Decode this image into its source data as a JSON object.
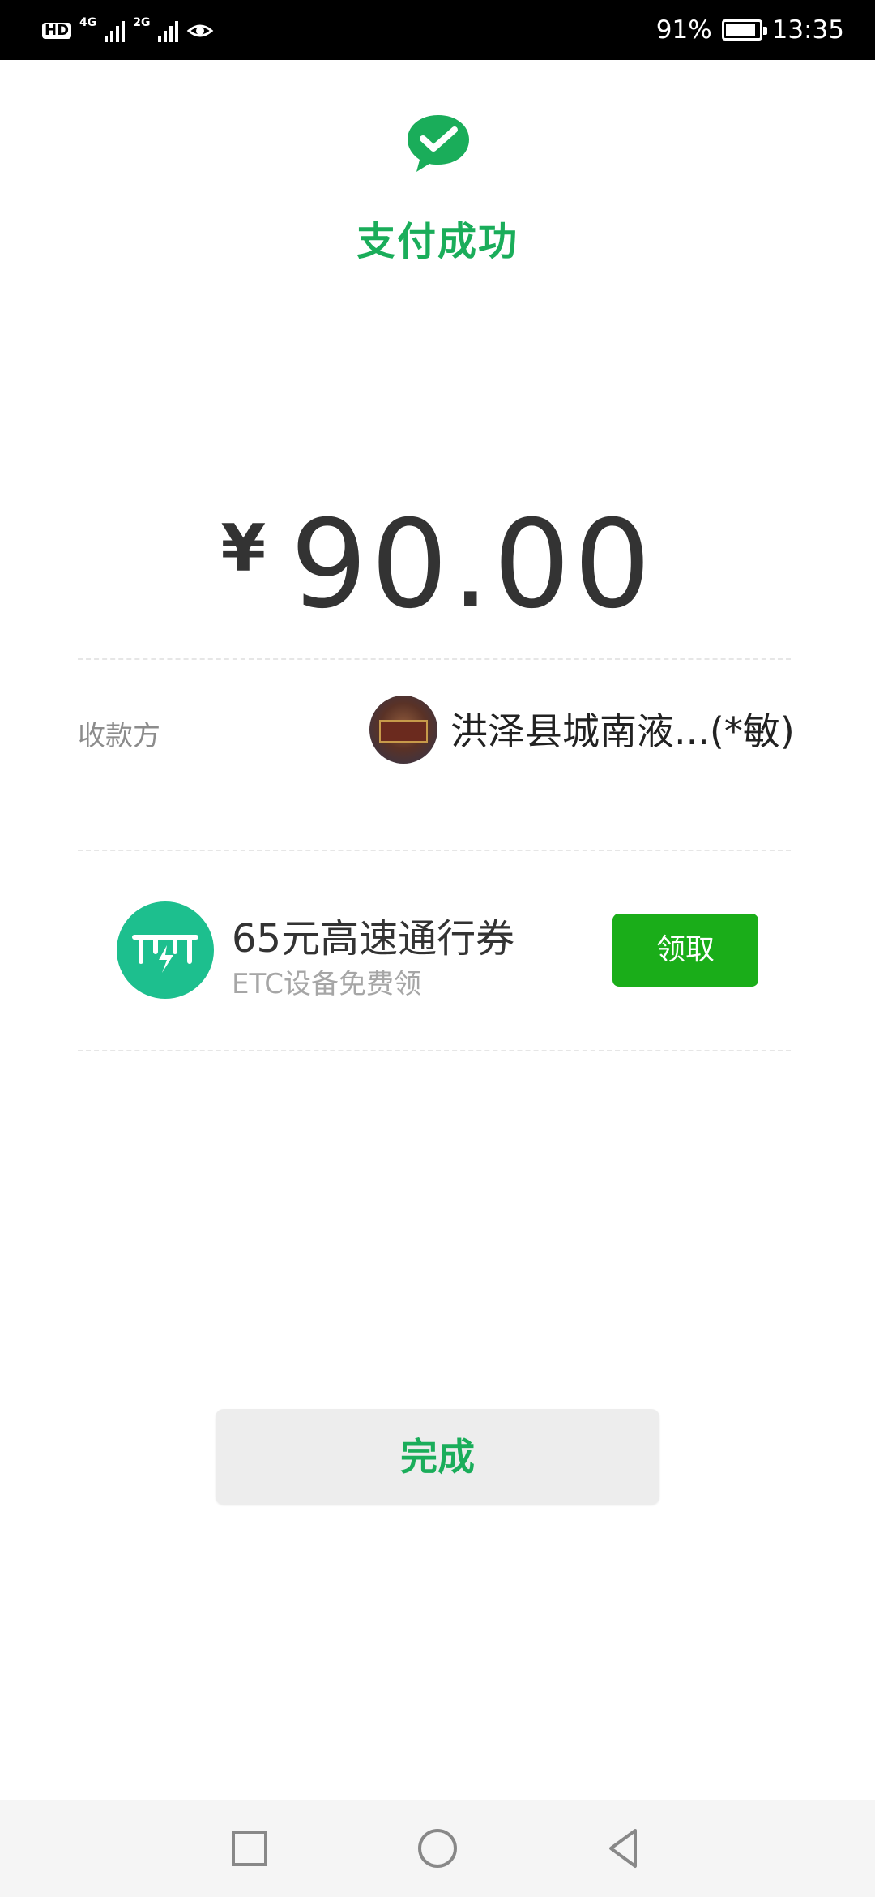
{
  "status_bar": {
    "network_hd": "HD",
    "network_1": "4G",
    "network_2": "2G",
    "battery_percent": "91%",
    "battery_level": 0.91,
    "time": "13:35"
  },
  "result": {
    "icon": "wechat-pay-check-icon",
    "title": "支付成功",
    "currency_symbol": "¥",
    "amount": "90.00"
  },
  "payee": {
    "label": "收款方",
    "name": "洪泽县城南液...(*敏)",
    "avatar": "merchant-avatar"
  },
  "promo": {
    "icon": "etc-icon",
    "title": "65元高速通行券",
    "subtitle": "ETC设备免费领",
    "button_label": "领取"
  },
  "actions": {
    "done_label": "完成"
  },
  "nav": {
    "recents": "square-icon",
    "home": "circle-icon",
    "back": "triangle-back-icon"
  },
  "colors": {
    "accent_green": "#1aad5a",
    "button_green": "#1aad19",
    "etc_teal": "#1dbf8e",
    "amount_text": "#333333"
  }
}
